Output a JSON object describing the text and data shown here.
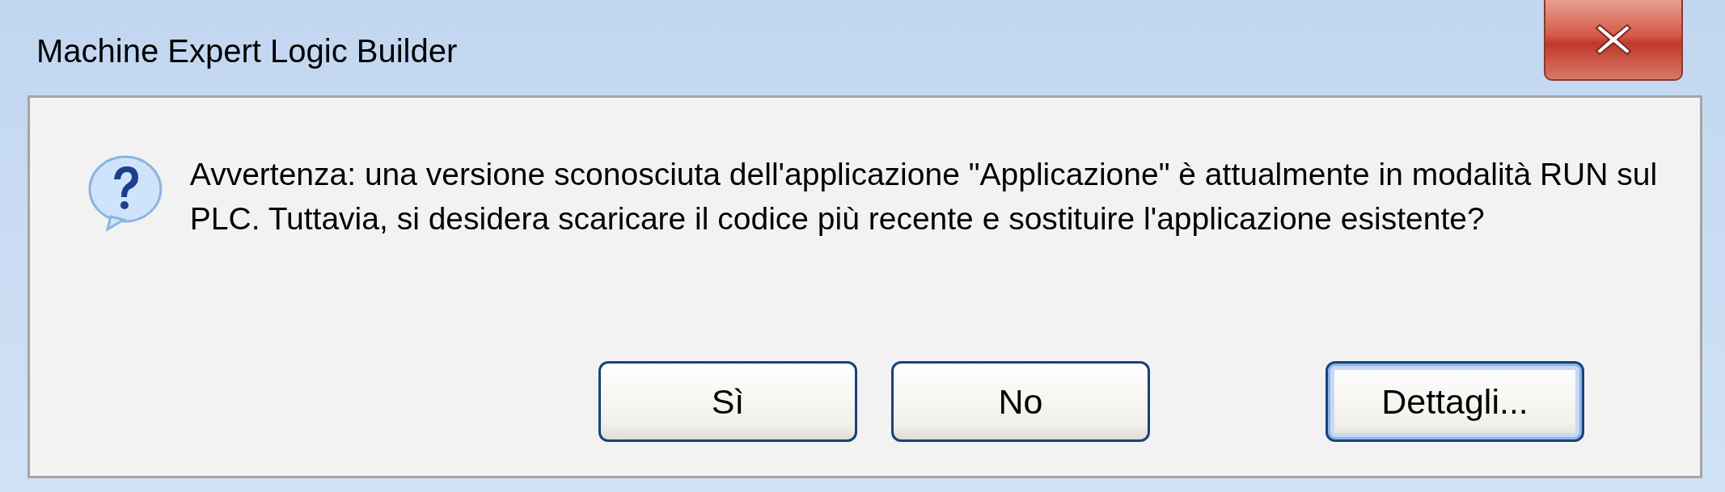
{
  "window": {
    "title": "Machine Expert Logic Builder"
  },
  "message": "Avvertenza: una versione sconosciuta dell'applicazione \"Applicazione\" è attualmente in modalità RUN sul PLC. Tuttavia, si desidera scaricare il codice più recente e sostituire l'applicazione esistente?",
  "buttons": [
    {
      "label": "Sì",
      "focused": false
    },
    {
      "label": "No",
      "focused": false
    },
    {
      "label": "Dettagli...",
      "focused": true
    }
  ]
}
